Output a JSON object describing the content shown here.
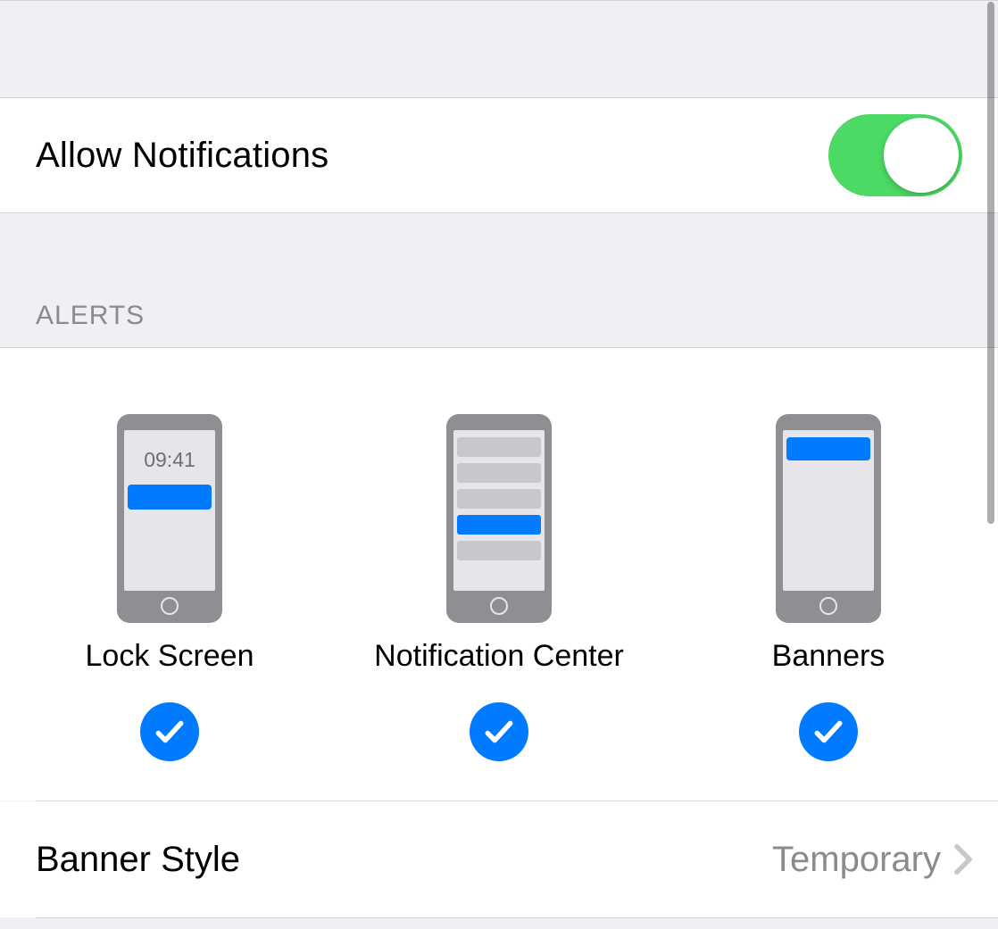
{
  "allowNotifications": {
    "label": "Allow Notifications",
    "enabled": true
  },
  "alertsSection": {
    "header": "ALERTS",
    "lockScreen": {
      "label": "Lock Screen",
      "time": "09:41",
      "checked": true
    },
    "notificationCenter": {
      "label": "Notification Center",
      "checked": true
    },
    "banners": {
      "label": "Banners",
      "checked": true
    }
  },
  "bannerStyle": {
    "label": "Banner Style",
    "value": "Temporary"
  },
  "colors": {
    "accent": "#007aff",
    "toggleOn": "#4cd964",
    "gray": "#8e8e93"
  }
}
